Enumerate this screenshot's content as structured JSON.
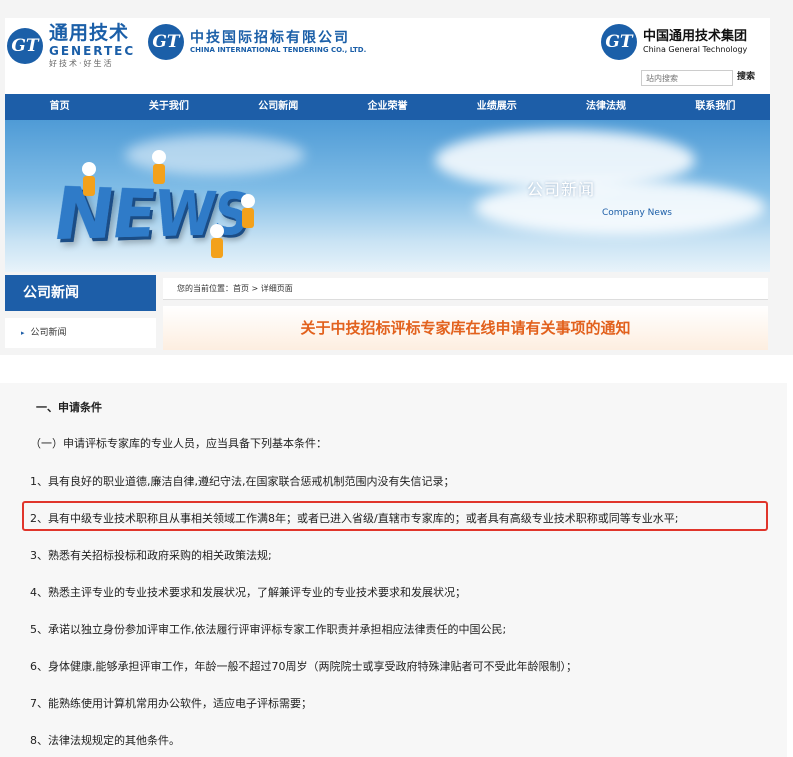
{
  "header": {
    "logo1": {
      "cn": "通用技术",
      "en": "GENERTEC",
      "slogan": "好技术·好生活",
      "mark": "GT"
    },
    "logo2": {
      "cn": "中技国际招标有限公司",
      "en": "CHINA INTERNATIONAL TENDERING CO., LTD."
    },
    "logo3": {
      "cn": "中国通用技术集团",
      "en": "China General Technology"
    },
    "search": {
      "placeholder": "站内搜索",
      "button": "搜索"
    }
  },
  "nav": [
    "首页",
    "关于我们",
    "公司新闻",
    "企业荣誉",
    "业绩展示",
    "法律法规",
    "联系我们"
  ],
  "banner": {
    "word": "NEWS",
    "title": "公司新闻",
    "subtitle": "Company News"
  },
  "sidebar": {
    "title": "公司新闻",
    "item": "公司新闻"
  },
  "breadcrumb": "您的当前位置：首页 > 详细页面",
  "article": {
    "title": "关于中技招标评标专家库在线申请有关事项的通知"
  },
  "content": {
    "heading": "一、申请条件",
    "lines": [
      "（一）申请评标专家库的专业人员，应当具备下列基本条件：",
      "1、具有良好的职业道德,廉洁自律,遵纪守法,在国家联合惩戒机制范围内没有失信记录；",
      "2、具有中级专业技术职称且从事相关领域工作满8年；或者已进入省级/直辖市专家库的；或者具有高级专业技术职称或同等专业水平;",
      "3、熟悉有关招标投标和政府采购的相关政策法规;",
      "4、熟悉主评专业的专业技术要求和发展状况，了解兼评专业的专业技术要求和发展状况；",
      "5、承诺以独立身份参加评审工作,依法履行评审评标专家工作职责并承担相应法律责任的中国公民;",
      "6、身体健康,能够承担评审工作，年龄一般不超过70周岁（两院院士或享受政府特殊津贴者可不受此年龄限制）；",
      "7、能熟练使用计算机常用办公软件，适应电子评标需要；",
      "8、法律法规规定的其他条件。"
    ],
    "highlighted_index": 2
  },
  "colors": {
    "brand_blue": "#1d5ea8",
    "title_orange": "#e2611d",
    "highlight_red": "#e0352b"
  }
}
